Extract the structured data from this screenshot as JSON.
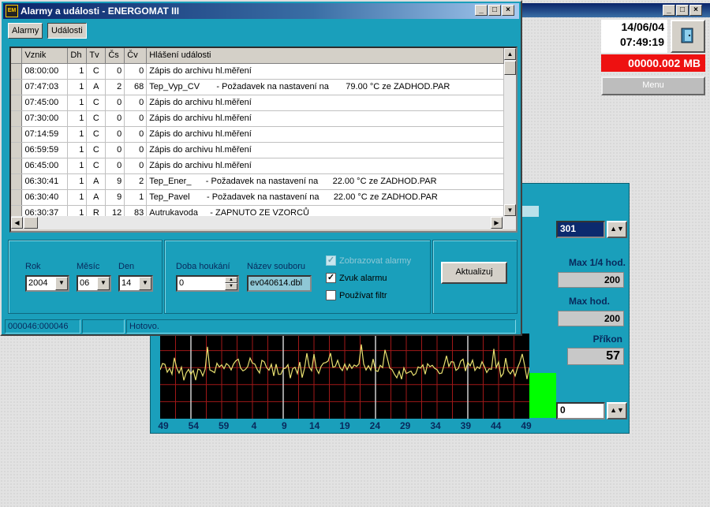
{
  "main_window": {
    "date": "14/06/04",
    "time": "07:49:19",
    "disk_usage": "00000.002 MB",
    "menu_label": "Menu",
    "window_buttons": [
      "_",
      "□",
      "×"
    ],
    "exit_icon": "door-exit-icon"
  },
  "graph_panel": {
    "top_input_value": "301",
    "max_quarter_label": "Max 1/4 hod.",
    "max_quarter_value": "200",
    "max_hour_label": "Max hod.",
    "max_hour_value": "200",
    "power_label": "Příkon",
    "power_value": "57",
    "bottom_input_value": "0",
    "spin_glyph": "▲▼",
    "x_ticks": [
      "49",
      "54",
      "59",
      "4",
      "9",
      "14",
      "19",
      "24",
      "29",
      "34",
      "39",
      "44",
      "49"
    ],
    "line_color": "#e8e070",
    "grid_color": "#a01818",
    "level_fraction": 0.55
  },
  "dialog": {
    "title": "Alarmy a události - ENERGOMAT III",
    "app_icon_text": "EM",
    "window_buttons": [
      "_",
      "□",
      "×"
    ],
    "tabs": [
      "Alarmy",
      "Události"
    ],
    "columns": [
      "Vznik",
      "Dh",
      "Tv",
      "Čs",
      "Čv",
      "Hlášení události"
    ],
    "rows": [
      [
        "08:00:00",
        "1",
        "C",
        "0",
        "0",
        "Zápis do archivu hl.měření"
      ],
      [
        "07:47:03",
        "1",
        "A",
        "2",
        "68",
        "Tep_Vyp_CV       - Požadavek na nastavení na       79.00 °C ze ZADHOD.PAR"
      ],
      [
        "07:45:00",
        "1",
        "C",
        "0",
        "0",
        "Zápis do archivu hl.měření"
      ],
      [
        "07:30:00",
        "1",
        "C",
        "0",
        "0",
        "Zápis do archivu hl.měření"
      ],
      [
        "07:14:59",
        "1",
        "C",
        "0",
        "0",
        "Zápis do archivu hl.měření"
      ],
      [
        "06:59:59",
        "1",
        "C",
        "0",
        "0",
        "Zápis do archivu hl.měření"
      ],
      [
        "06:45:00",
        "1",
        "C",
        "0",
        "0",
        "Zápis do archivu hl.měření"
      ],
      [
        "06:30:41",
        "1",
        "A",
        "9",
        "2",
        "Tep_Ener_      - Požadavek na nastavení na      22.00 °C ze ZADHOD.PAR"
      ],
      [
        "06:30:40",
        "1",
        "A",
        "9",
        "1",
        "Tep_Pavel       - Požadavek na nastavení na      22.00 °C ze ZADHOD.PAR"
      ],
      [
        "06:30:37",
        "1",
        "R",
        "12",
        "83",
        "Autrukavoda     - ZAPNUTO ZE VZORCŮ"
      ]
    ],
    "filters": {
      "year_label": "Rok",
      "year_value": "2004",
      "month_label": "Měsíc",
      "month_value": "06",
      "day_label": "Den",
      "day_value": "14",
      "duration_label": "Doba houkání",
      "duration_value": "0",
      "file_label": "Název souboru",
      "file_value": "ev040614.dbl",
      "show_alarms_label": "Zobrazovat alarmy",
      "sound_label": "Zvuk alarmu",
      "filter_label": "Používat filtr",
      "refresh_label": "Aktualizuj"
    },
    "status": {
      "counter": "000046:000046",
      "message": "Hotovo."
    }
  }
}
